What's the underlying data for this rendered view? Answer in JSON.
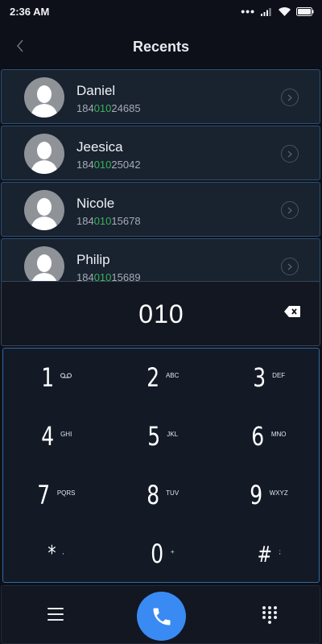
{
  "status_bar": {
    "time": "2:36 AM",
    "dots": "•••",
    "icons": [
      "signal-icon",
      "wifi-icon",
      "battery-icon"
    ]
  },
  "header": {
    "title": "Recents",
    "back_icon": "chevron-left-icon"
  },
  "contacts": [
    {
      "name": "Daniel",
      "number_prefix": "184",
      "number_match": "010",
      "number_suffix": "24685"
    },
    {
      "name": "Jeesica",
      "number_prefix": "184",
      "number_match": "010",
      "number_suffix": "25042"
    },
    {
      "name": "Nicole",
      "number_prefix": "184",
      "number_match": "010",
      "number_suffix": "15678"
    },
    {
      "name": "Philip",
      "number_prefix": "184",
      "number_match": "010",
      "number_suffix": "15689"
    }
  ],
  "dialer": {
    "entered_number": "010",
    "backspace_icon": "backspace-icon"
  },
  "keypad": {
    "keys": [
      {
        "digit": "1",
        "letters": ""
      },
      {
        "digit": "2",
        "letters": "ABC"
      },
      {
        "digit": "3",
        "letters": "DEF"
      },
      {
        "digit": "4",
        "letters": "GHI"
      },
      {
        "digit": "5",
        "letters": "JKL"
      },
      {
        "digit": "6",
        "letters": "MNO"
      },
      {
        "digit": "7",
        "letters": "PQRS"
      },
      {
        "digit": "8",
        "letters": "TUV"
      },
      {
        "digit": "9",
        "letters": "WXYZ"
      },
      {
        "digit": "*",
        "letters": ","
      },
      {
        "digit": "0",
        "letters": "+"
      },
      {
        "digit": "#",
        "letters": ";"
      }
    ]
  },
  "bottom_bar": {
    "menu_icon": "menu-icon",
    "call_icon": "phone-icon",
    "keypad_icon": "dialpad-icon"
  },
  "colors": {
    "background": "#0d1018",
    "row_background": "#19222f",
    "row_border": "#2c5076",
    "match_green": "#37b457",
    "call_blue": "#3a8af3",
    "keypad_border": "#2f6aa3"
  }
}
